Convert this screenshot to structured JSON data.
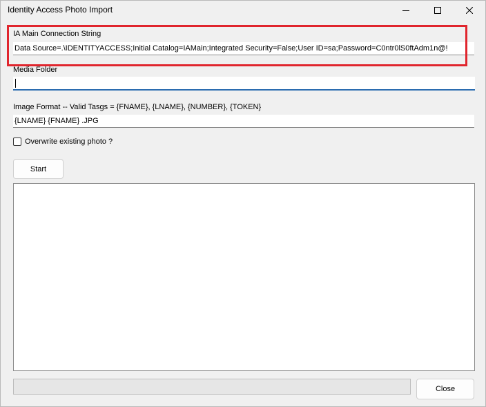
{
  "window": {
    "title": "Identity Access Photo Import",
    "controls": {
      "minimize": "minimize-icon",
      "maximize": "maximize-icon",
      "close": "close-icon"
    }
  },
  "connection": {
    "label": "IA Main Connection String",
    "value": "Data Source=.\\IDENTITYACCESS;Initial Catalog=IAMain;Integrated Security=False;User ID=sa;Password=C0ntr0lS0ftAdm1n@!"
  },
  "media_folder": {
    "label": "Media Folder",
    "value": ""
  },
  "image_format": {
    "label": "Image Format -- Valid Tasgs = {FNAME}, {LNAME}, {NUMBER}, {TOKEN}",
    "value": "{LNAME} {FNAME} .JPG"
  },
  "overwrite": {
    "label": "Overwrite existing photo ?",
    "checked": false
  },
  "start_button": {
    "label": "Start"
  },
  "close_button": {
    "label": "Close"
  },
  "progress": {
    "value": 0
  },
  "colors": {
    "highlight": "#e0252d",
    "focus": "#2b6cb0"
  }
}
